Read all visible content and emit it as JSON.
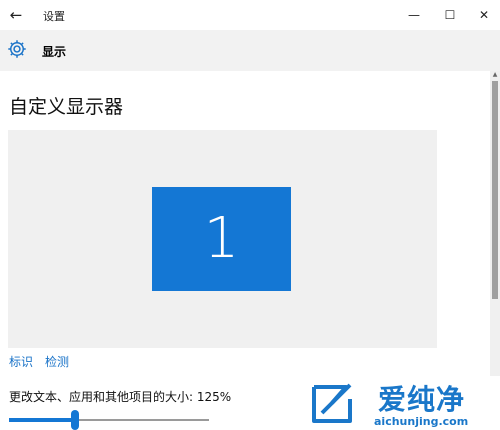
{
  "window": {
    "title": "设置",
    "back_glyph": "←",
    "minimize_glyph": "—",
    "maximize_glyph": "☐",
    "close_glyph": "✕"
  },
  "header": {
    "icon": "gear-icon",
    "title": "显示"
  },
  "main": {
    "section_title": "自定义显示器",
    "monitor_number": "1",
    "monitor_color": "#1477d4",
    "identify_link": "标识",
    "detect_link": "检测",
    "scale_label": "更改文本、应用和其他项目的大小: 125%",
    "scale_slider_fraction": 0.33
  },
  "watermark": {
    "text": "爱纯净",
    "url": "aichunjing.com",
    "color": "#1a77c9"
  },
  "accent_color": "#1a73c8"
}
